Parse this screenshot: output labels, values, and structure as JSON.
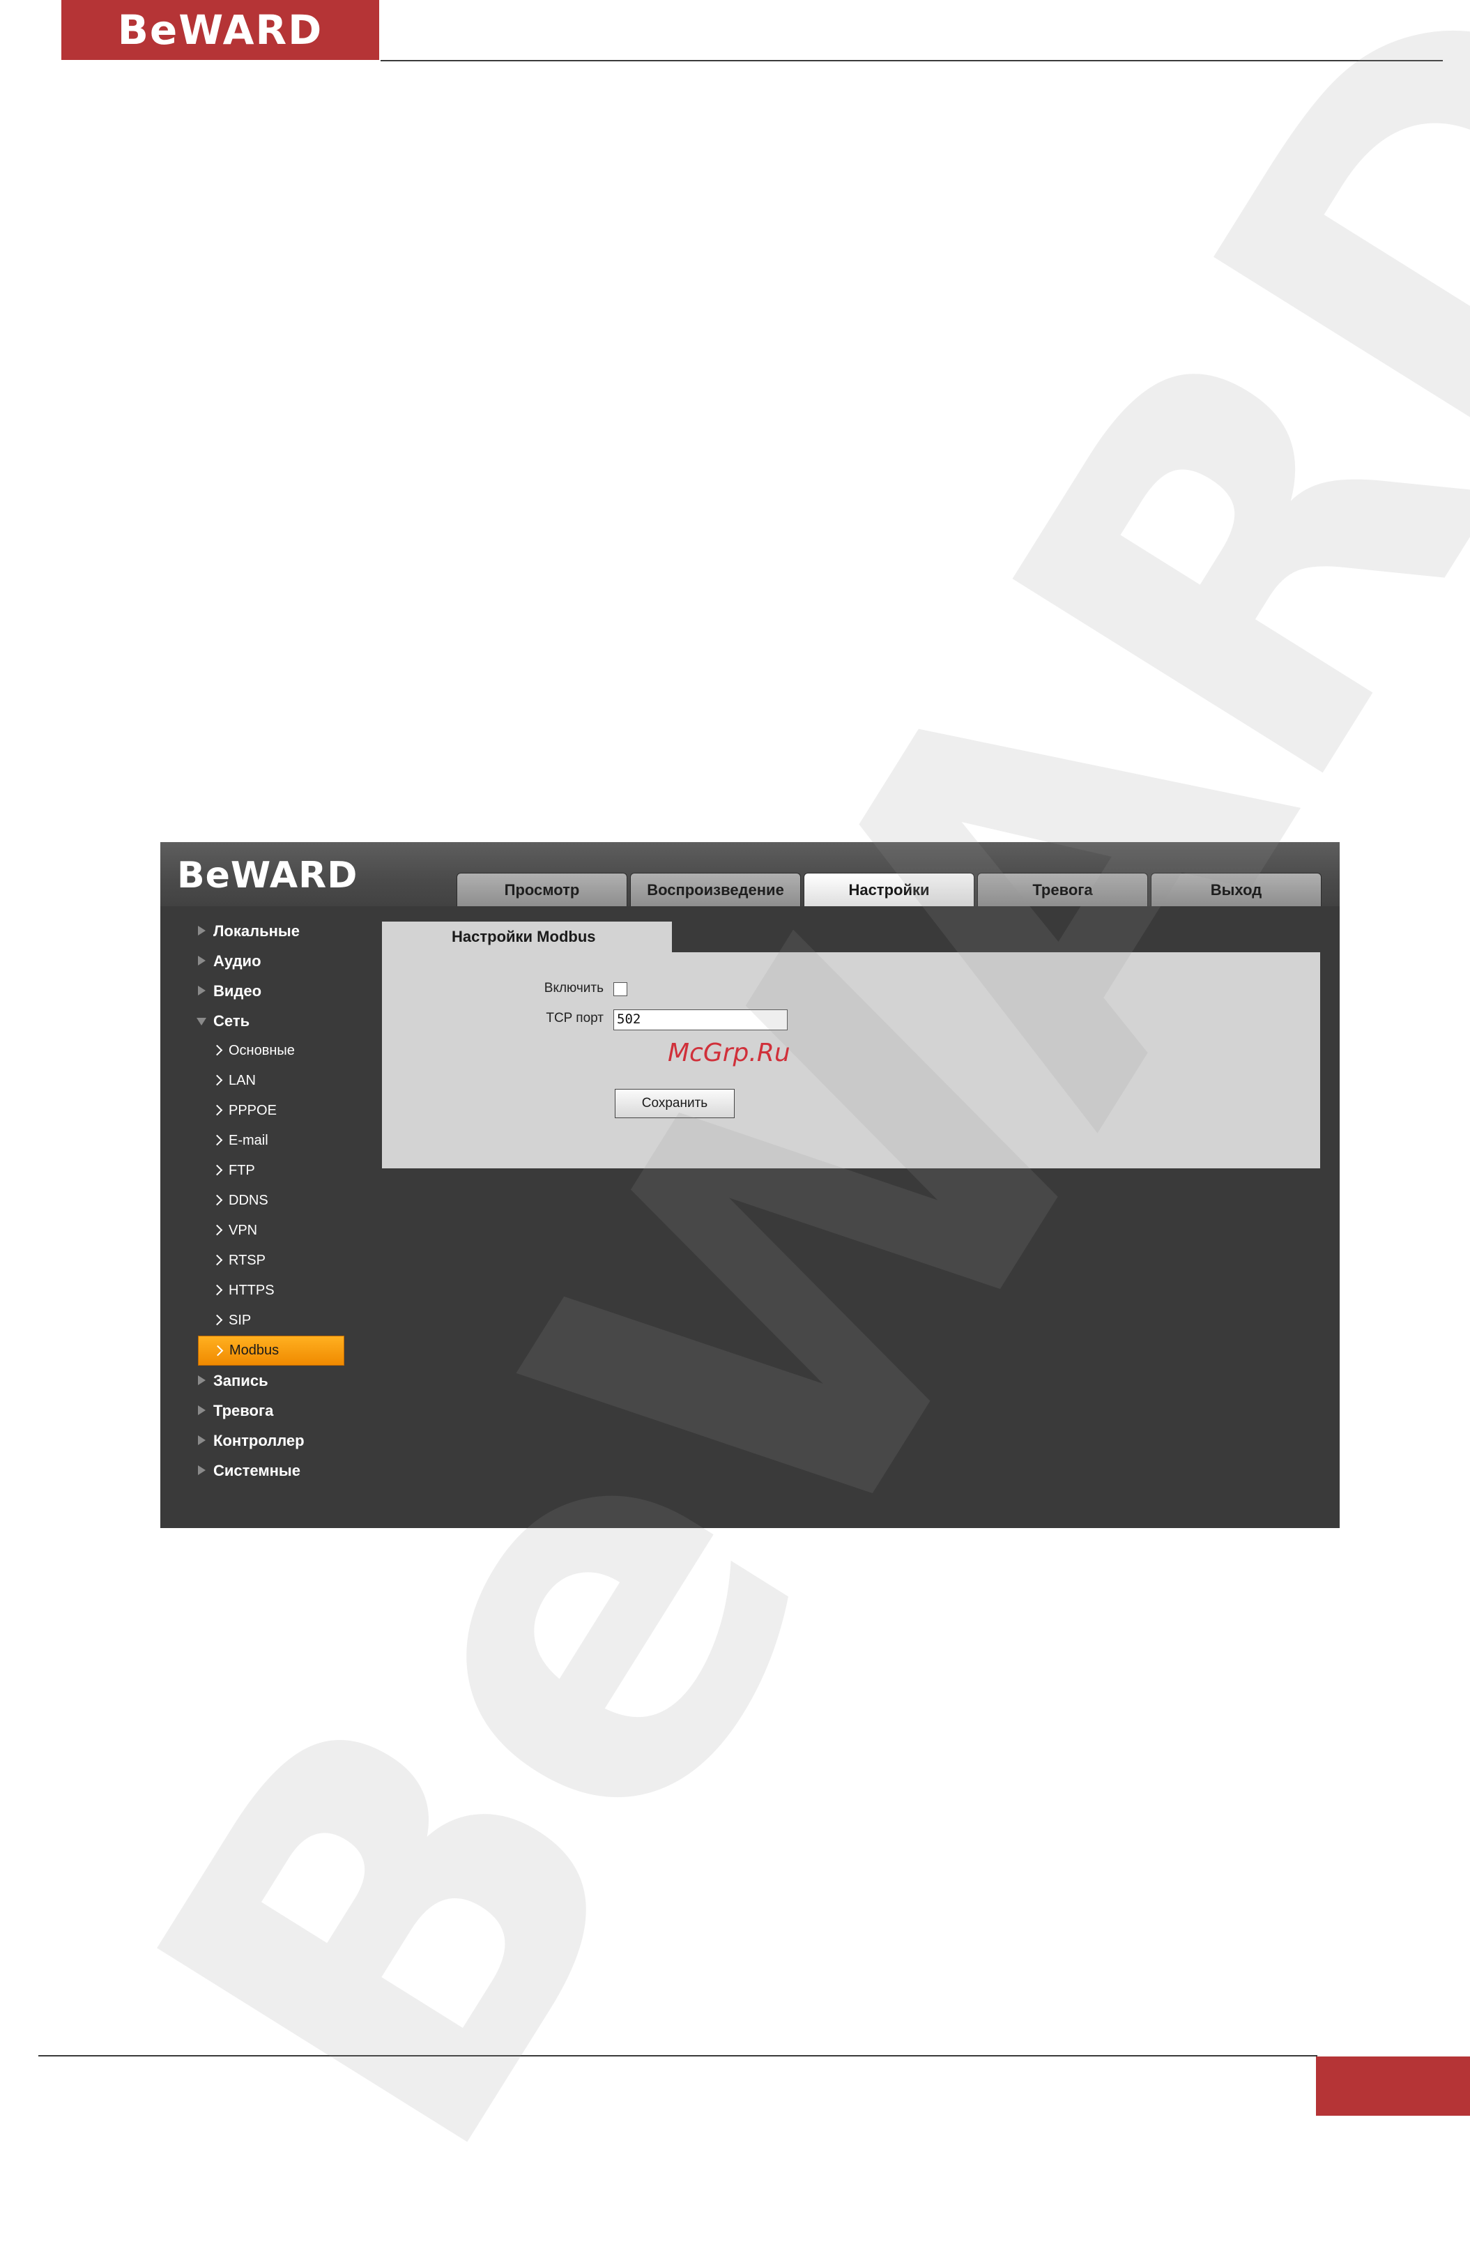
{
  "document": {
    "header_logo": "BeWARD",
    "watermark": "BeWARD"
  },
  "app": {
    "logo": "BeWARD",
    "tabs": [
      {
        "label": "Просмотр",
        "active": false
      },
      {
        "label": "Воспроизведение",
        "active": false
      },
      {
        "label": "Настройки",
        "active": true
      },
      {
        "label": "Тревога",
        "active": false
      },
      {
        "label": "Выход",
        "active": false
      }
    ],
    "sidebar": {
      "top_items": [
        {
          "label": "Локальные"
        },
        {
          "label": "Аудио"
        },
        {
          "label": "Видео"
        }
      ],
      "network": {
        "label": "Сеть",
        "expanded": true,
        "sub_items": [
          "Основные",
          "LAN",
          "PPPOE",
          "E-mail",
          "FTP",
          "DDNS",
          "VPN",
          "RTSP",
          "HTTPS",
          "SIP",
          "Modbus"
        ],
        "selected": "Modbus"
      },
      "bottom_items": [
        {
          "label": "Запись"
        },
        {
          "label": "Тревога"
        },
        {
          "label": "Контроллер"
        },
        {
          "label": "Системные"
        }
      ]
    },
    "content": {
      "title": "Настройки Modbus",
      "enable_label": "Включить",
      "enable_checked": false,
      "tcp_port_label": "TCP порт",
      "tcp_port_value": "502",
      "save_label": "Сохранить",
      "site_mark": "McGrp.Ru"
    },
    "colors": {
      "brand_red": "#b53436",
      "selected_orange": "#f7a000",
      "panel_gray": "#d3d3d3",
      "background_dark": "#3a3a3a"
    }
  }
}
